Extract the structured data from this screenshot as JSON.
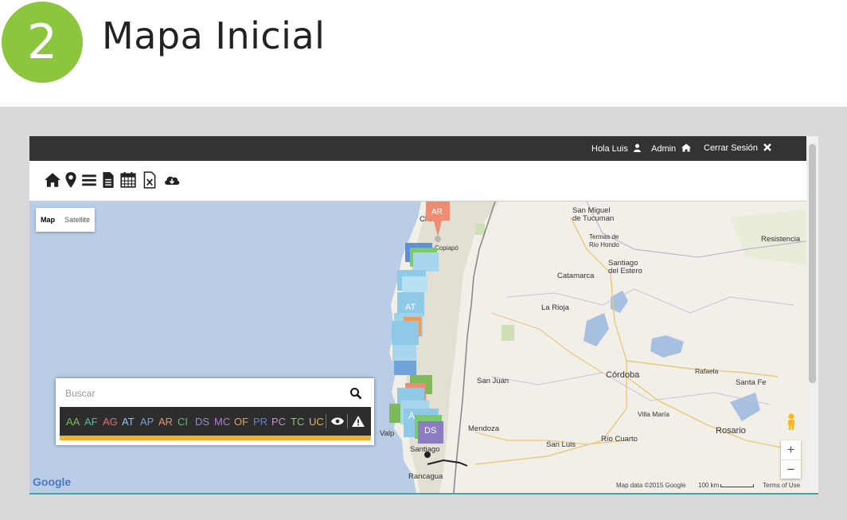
{
  "step": {
    "number": "2",
    "title": "Mapa Inicial"
  },
  "topbar": {
    "greeting": "Hola Luis",
    "admin": "Admin",
    "logout": "Cerrar Sesión"
  },
  "toolbar": {
    "icons": [
      "home-icon",
      "map-pin-icon",
      "list-icon",
      "document-icon",
      "calendar-icon",
      "excel-icon",
      "cloud-download-icon"
    ]
  },
  "map": {
    "type_options": {
      "map": "Map",
      "satellite": "Satellite"
    },
    "cities": {
      "san_miguel_1": "San Miguel",
      "san_miguel_2": "de Tucuman",
      "termas_1": "Termas de",
      "termas_2": "Rio Hondo",
      "resistencia": "Resistencia",
      "catamarca": "Catamarca",
      "santiago_estero_1": "Santiago",
      "santiago_estero_2": "del Estero",
      "la_rioja": "La Rioja",
      "rafaela": "Rafaela",
      "cordoba": "Córdoba",
      "san_juan": "San Juan",
      "santa_fe": "Santa Fe",
      "villa_maria": "Villa María",
      "mendoza": "Mendoza",
      "rosario": "Rosario",
      "san_luis": "San Luis",
      "rio_cuarto": "Río Cuarto",
      "rancagua": "Rancagua",
      "santiago": "Santiago",
      "copiapo": "Copiapó",
      "chile": "Chile",
      "valparaiso": "Valp"
    },
    "markers": {
      "ar_top": "AR",
      "at": "AT",
      "ds": "DS",
      "a_mid": "A"
    },
    "attribution": {
      "map_data": "Map data ©2015 Google",
      "scale": "100 km",
      "terms": "Terms of Use",
      "logo": "Google"
    },
    "zoom": {
      "in": "+",
      "out": "−"
    }
  },
  "panel": {
    "search_placeholder": "Buscar",
    "categories": [
      {
        "label": "AA",
        "color": "#7dbb5a"
      },
      {
        "label": "AF",
        "color": "#5fb6a5"
      },
      {
        "label": "AG",
        "color": "#e0716f"
      },
      {
        "label": "AT",
        "color": "#8ec9e6"
      },
      {
        "label": "AP",
        "color": "#6fa3d9"
      },
      {
        "label": "AR",
        "color": "#ef8d73"
      },
      {
        "label": "CI",
        "color": "#63b874"
      },
      {
        "label": "DS",
        "color": "#9b8ad0"
      },
      {
        "label": "MC",
        "color": "#b07ccf"
      },
      {
        "label": "OF",
        "color": "#e5a24a"
      },
      {
        "label": "PR",
        "color": "#6b7ec7"
      },
      {
        "label": "PC",
        "color": "#c68ec9"
      },
      {
        "label": "TC",
        "color": "#88c07a"
      },
      {
        "label": "UC",
        "color": "#e0b84c"
      }
    ]
  },
  "colors": {
    "badge": "#8cc63f",
    "topbar": "#333333",
    "water": "#b9cde6",
    "land": "#f0ede5",
    "accent_bar": "#f0b22f"
  }
}
